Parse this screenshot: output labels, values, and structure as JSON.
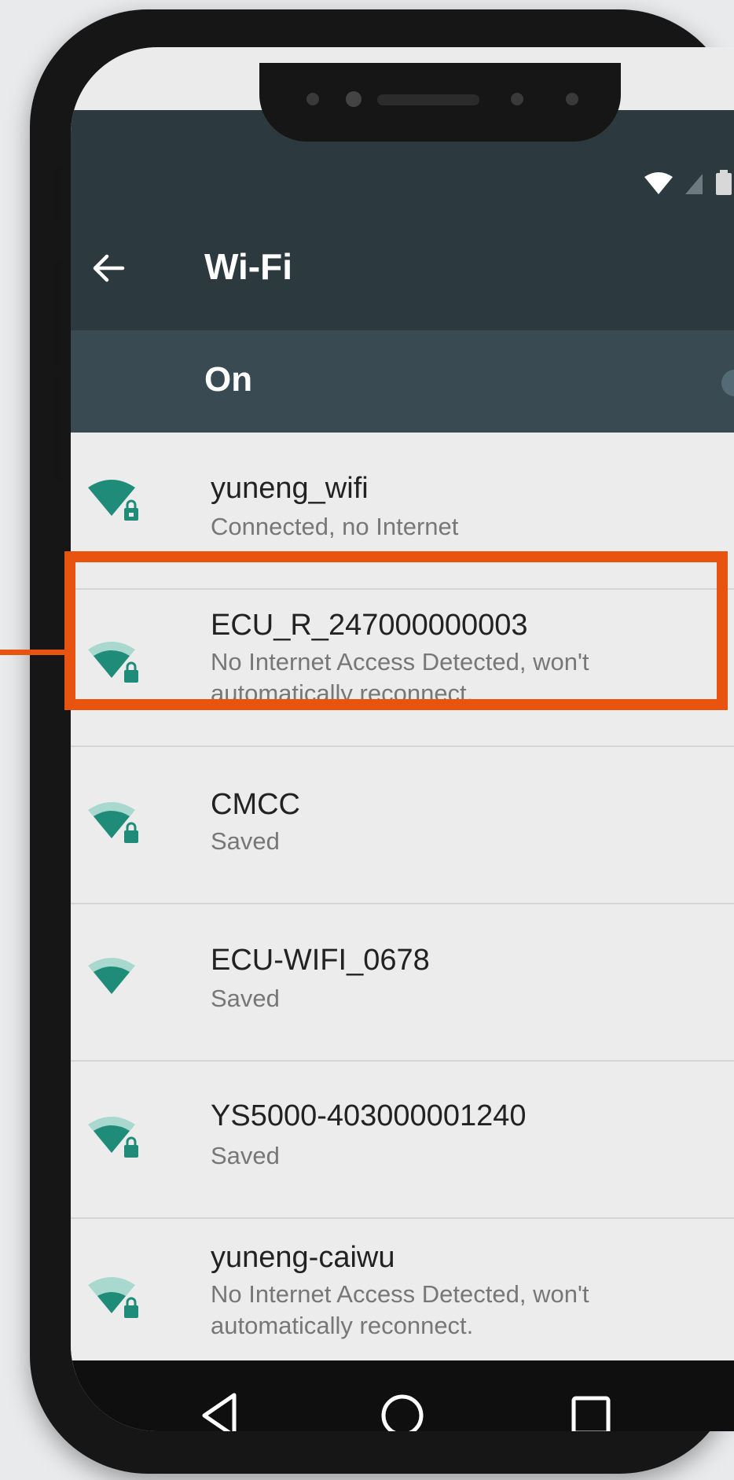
{
  "app": {
    "title": "Wi-Fi",
    "master_switch_label": "On",
    "back_icon": "arrow-back-icon"
  },
  "status_bar": {
    "icons": [
      "wifi-signal-icon",
      "cell-signal-icon",
      "battery-icon"
    ]
  },
  "networks": [
    {
      "ssid": "yuneng_wifi",
      "status": "Connected, no Internet",
      "locked": true,
      "signal": "full",
      "highlighted": false
    },
    {
      "ssid": "ECU_R_247000000003",
      "status": "No Internet Access Detected, won't automatically reconnect.",
      "locked": true,
      "signal": "medium",
      "highlighted": true
    },
    {
      "ssid": "CMCC",
      "status": "Saved",
      "locked": true,
      "signal": "medium",
      "highlighted": false
    },
    {
      "ssid": "ECU-WIFI_0678",
      "status": "Saved",
      "locked": false,
      "signal": "medium",
      "highlighted": false
    },
    {
      "ssid": "YS5000-403000001240",
      "status": "Saved",
      "locked": true,
      "signal": "medium",
      "highlighted": false
    },
    {
      "ssid": "yuneng-caiwu",
      "status": "No Internet Access Detected, won't automatically reconnect.",
      "locked": true,
      "signal": "low",
      "highlighted": false
    }
  ],
  "nav_bar": {
    "icons": [
      "back-triangle-icon",
      "home-circle-icon",
      "recents-square-icon"
    ]
  },
  "colors": {
    "toolbar": "#2c3a40",
    "master_bar": "#3a4a52",
    "wifi_icon": "#1f8c7a",
    "wifi_icon_faint": "#a9d8cf",
    "highlight": "#e8540f",
    "list_background": "#ececec"
  }
}
